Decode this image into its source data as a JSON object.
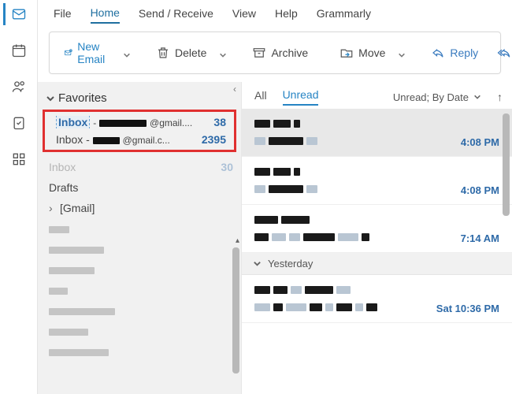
{
  "menu": {
    "file": "File",
    "home": "Home",
    "send_receive": "Send / Receive",
    "view": "View",
    "help": "Help",
    "grammarly": "Grammarly"
  },
  "ribbon": {
    "new_email": "New Email",
    "delete": "Delete",
    "archive": "Archive",
    "move": "Move",
    "reply": "Reply",
    "reply_all_partial": "R"
  },
  "folders": {
    "favorites_label": "Favorites",
    "inbox1": {
      "label_prefix": "Inbox",
      "account_suffix": "@gmail....",
      "count": "38"
    },
    "inbox2": {
      "label_prefix": "Inbox - ",
      "account_suffix": "@gmail.c...",
      "count": "2395"
    },
    "inbox3": {
      "label": "Inbox",
      "count": "30"
    },
    "drafts": "Drafts",
    "gmail_group": "[Gmail]"
  },
  "messages": {
    "filter_all": "All",
    "filter_unread": "Unread",
    "sort": "Unread; By Date",
    "group_yesterday": "Yesterday",
    "items": [
      {
        "time": "4:08 PM"
      },
      {
        "time": "4:08 PM"
      },
      {
        "time": "7:14 AM"
      },
      {
        "time": "Sat 10:36 PM"
      }
    ]
  }
}
